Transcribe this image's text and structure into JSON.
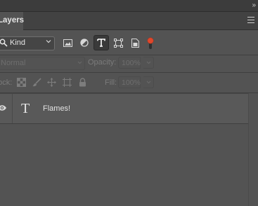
{
  "panel": {
    "title": "Layers",
    "collapse_glyph": "»",
    "menu_icon": "hamburger-icon"
  },
  "filter": {
    "kind_value": "Kind",
    "filter_icons": [
      "image-filter-icon",
      "adjustment-filter-icon",
      "type-filter-icon",
      "shape-filter-icon",
      "smart-object-filter-icon"
    ],
    "toggle_color": "#e0472b"
  },
  "blend": {
    "mode_value": "Normal",
    "opacity_label": "Opacity:",
    "opacity_value": "100%"
  },
  "lock": {
    "label": "Lock:",
    "icons": [
      "lock-transparent-pixels-icon",
      "lock-image-pixels-icon",
      "lock-position-icon",
      "lock-artboard-icon",
      "lock-all-icon"
    ],
    "fill_label": "Fill:",
    "fill_value": "100%"
  },
  "layers": [
    {
      "name": "Flames!",
      "type_glyph": "T",
      "visible": true
    }
  ]
}
